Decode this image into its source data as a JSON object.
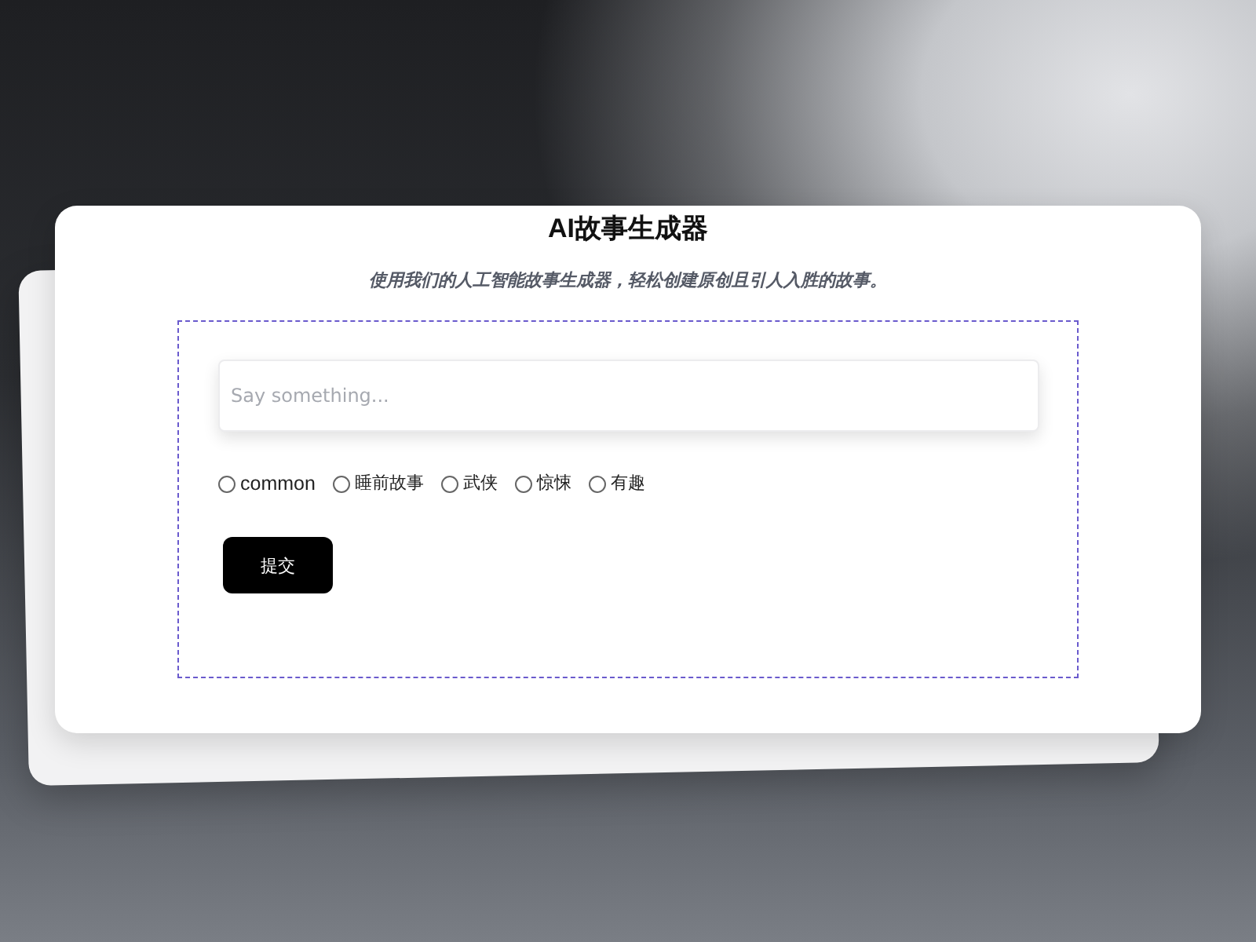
{
  "title": "AI故事生成器",
  "subtitle": "使用我们的人工智能故事生成器，轻松创建原创且引人入胜的故事。",
  "story_input": {
    "placeholder": "Say something..."
  },
  "genres": [
    {
      "label": "common",
      "selected": false
    },
    {
      "label": "睡前故事",
      "selected": false
    },
    {
      "label": "武侠",
      "selected": false
    },
    {
      "label": "惊悚",
      "selected": false
    },
    {
      "label": "有趣",
      "selected": false
    }
  ],
  "submit_button": "提交"
}
